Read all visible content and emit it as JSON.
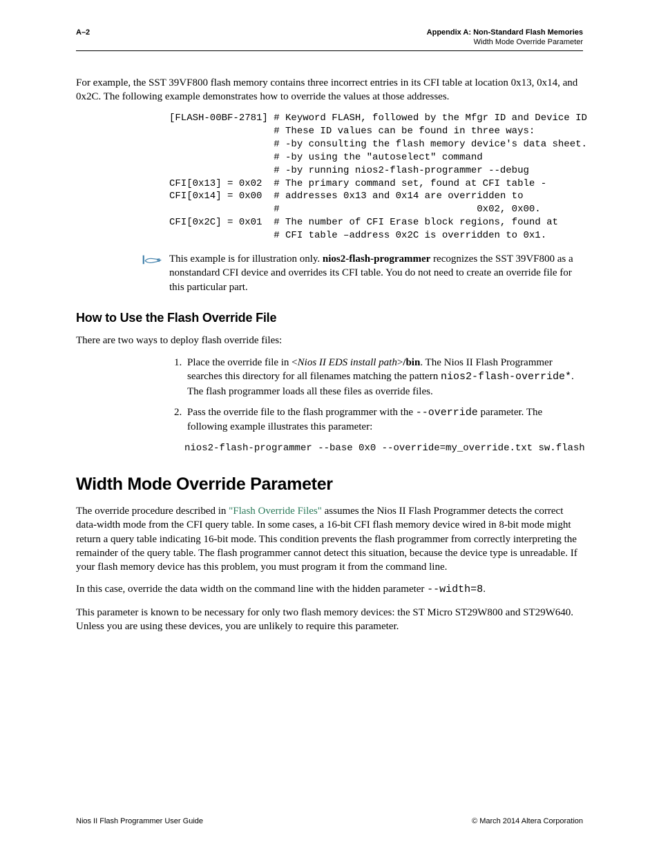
{
  "header": {
    "page_number": "A–2",
    "appendix_line": "Appendix A:  Non-Standard Flash Memories",
    "section_line": "Width Mode Override Parameter"
  },
  "p1": "For example, the SST 39VF800 flash memory contains three incorrect entries in its CFI table at location 0x13, 0x14, and 0x2C. The following example demonstrates how to override the values at those addresses.",
  "code1": "[FLASH-00BF-2781] # Keyword FLASH, followed by the Mfgr ID and Device ID\n                  # These ID values can be found in three ways:\n                  # -by consulting the flash memory device's data sheet.\n                  # -by using the \"autoselect\" command\n                  # -by running nios2-flash-programmer --debug\nCFI[0x13] = 0x02  # The primary command set, found at CFI table -\nCFI[0x14] = 0x00  # addresses 0x13 and 0x14 are overridden to\n                  #                                  0x02, 0x00.\nCFI[0x2C] = 0x01  # The number of CFI Erase block regions, found at\n                  # CFI table –address 0x2C is overridden to 0x1.",
  "note": {
    "t1": "This example is for illustration only. ",
    "bold": "nios2-flash-programmer",
    "t2": " recognizes the SST 39VF800 as a nonstandard CFI device and overrides its CFI table. You do not need to create an override file for this particular part."
  },
  "h2_howto": "How to Use the Flash Override File",
  "p2": "There are two ways to deploy flash override files:",
  "li1": {
    "t1": "Place the override file in <",
    "it": "Nios II EDS install path",
    "t2": ">",
    "b": "/bin",
    "t3": ". The Nios II Flash Programmer searches this directory for all filenames matching the pattern ",
    "m1": "nios2-flash-override*",
    "t4": ". The flash programmer loads all these files as override files."
  },
  "li2": {
    "t1": "Pass the override file to the flash programmer with the ",
    "m1": "--override",
    "t2": " parameter. The following example illustrates this parameter:"
  },
  "code2": "nios2-flash-programmer --base 0x0 --override=my_override.txt sw.flash",
  "h1_width": "Width Mode Override Parameter",
  "p3": {
    "t1": "The override procedure described in ",
    "link": "\"Flash Override Files\"",
    "t2": " assumes the Nios II Flash Programmer detects the correct data-width mode from the CFI query table. In some cases, a 16-bit CFI flash memory device wired in 8-bit mode might return a query table indicating 16-bit mode. This condition prevents the flash programmer from correctly interpreting the remainder of the query table. The flash programmer cannot detect this situation, because the device type is unreadable. If your flash memory device has this problem, you must program it from the command line."
  },
  "p4": {
    "t1": "In this case, override the data width on the command line with the hidden parameter ",
    "m1": "--width=8",
    "t2": "."
  },
  "p5": "This parameter is known to be necessary for only two flash memory devices: the ST Micro ST29W800 and ST29W640. Unless you are using these devices, you are unlikely to require this parameter.",
  "footer": {
    "left": "Nios II Flash Programmer User Guide",
    "right": "© March 2014   Altera Corporation"
  }
}
